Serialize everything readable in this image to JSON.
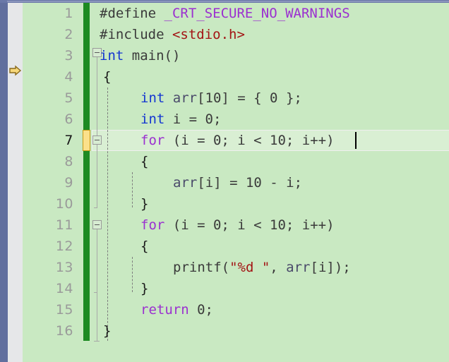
{
  "editor": {
    "title": "code-editor",
    "language": "C",
    "theme_background": "#c9e9c2",
    "current_line": 7,
    "total_lines": 16,
    "colors": {
      "background": "#c9e9c2",
      "current_line_highlight": "#d9efd3",
      "gutter": "#e6e7e9",
      "left_band": "#616f9e",
      "saved_change_bar": "#1d8a22",
      "unsaved_change_bar": "#fbe08a",
      "line_number": "#9a9a9a",
      "line_number_active": "#1a1a1a",
      "keyword": "#9b30d0",
      "type": "#1436d1",
      "string": "#a31515",
      "macro": "#9b30d0",
      "plain": "#3a3a3a"
    }
  },
  "gutter": {
    "bookmark_icon": "arrow-right-icon",
    "bookmark_line": 4,
    "line_numbers": [
      1,
      2,
      3,
      4,
      5,
      6,
      7,
      8,
      9,
      10,
      11,
      12,
      13,
      14,
      15,
      16
    ]
  },
  "outlining": {
    "collapse_icon": "minus-square-icon",
    "regions": [
      {
        "line": 3,
        "state": "expanded"
      },
      {
        "line": 7,
        "state": "expanded"
      },
      {
        "line": 11,
        "state": "expanded"
      }
    ]
  },
  "code": {
    "lines": [
      {
        "n": 1,
        "text": "#define _CRT_SECURE_NO_WARNINGS"
      },
      {
        "n": 2,
        "text": "#include <stdio.h>"
      },
      {
        "n": 3,
        "text": "int main()"
      },
      {
        "n": 4,
        "text": "{"
      },
      {
        "n": 5,
        "text": "    int arr[10] = { 0 };"
      },
      {
        "n": 6,
        "text": "    int i = 0;"
      },
      {
        "n": 7,
        "text": "    for (i = 0; i < 10; i++)"
      },
      {
        "n": 8,
        "text": "    {"
      },
      {
        "n": 9,
        "text": "        arr[i] = 10 - i;"
      },
      {
        "n": 10,
        "text": "    }"
      },
      {
        "n": 11,
        "text": "    for (i = 0; i < 10; i++)"
      },
      {
        "n": 12,
        "text": "    {"
      },
      {
        "n": 13,
        "text": "        printf(\"%d \", arr[i]);"
      },
      {
        "n": 14,
        "text": "    }"
      },
      {
        "n": 15,
        "text": "    return 0;"
      },
      {
        "n": 16,
        "text": "}"
      }
    ],
    "tokens": {
      "l1_a": "#define",
      "l1_b": " ",
      "l1_c": "_CRT_SECURE_NO_WARNINGS",
      "l2_a": "#include",
      "l2_b": " ",
      "l2_c": "<stdio.h>",
      "l3_a": "int",
      "l3_b": " main()",
      "l4_a": "{",
      "l5_a": "int",
      "l5_b": " ",
      "l5_c": "arr",
      "l5_d": "[10] = { 0 };",
      "l6_a": "int",
      "l6_b": " i = 0;",
      "l7_a": "for",
      "l7_b": " (i = 0; i < 10; i++)",
      "l8_a": "{",
      "l9_a": "arr",
      "l9_b": "[i] = 10 - i;",
      "l10_a": "}",
      "l11_a": "for",
      "l11_b": " (i = 0; i < 10; i++)",
      "l12_a": "{",
      "l13_a": "printf(",
      "l13_b": "\"%d \"",
      "l13_c": ", ",
      "l13_d": "arr",
      "l13_e": "[i]);",
      "l14_a": "}",
      "l15_a": "return",
      "l15_b": " 0;",
      "l16_a": "}"
    }
  },
  "caret": {
    "line": 7,
    "column": 29,
    "visible": true
  }
}
